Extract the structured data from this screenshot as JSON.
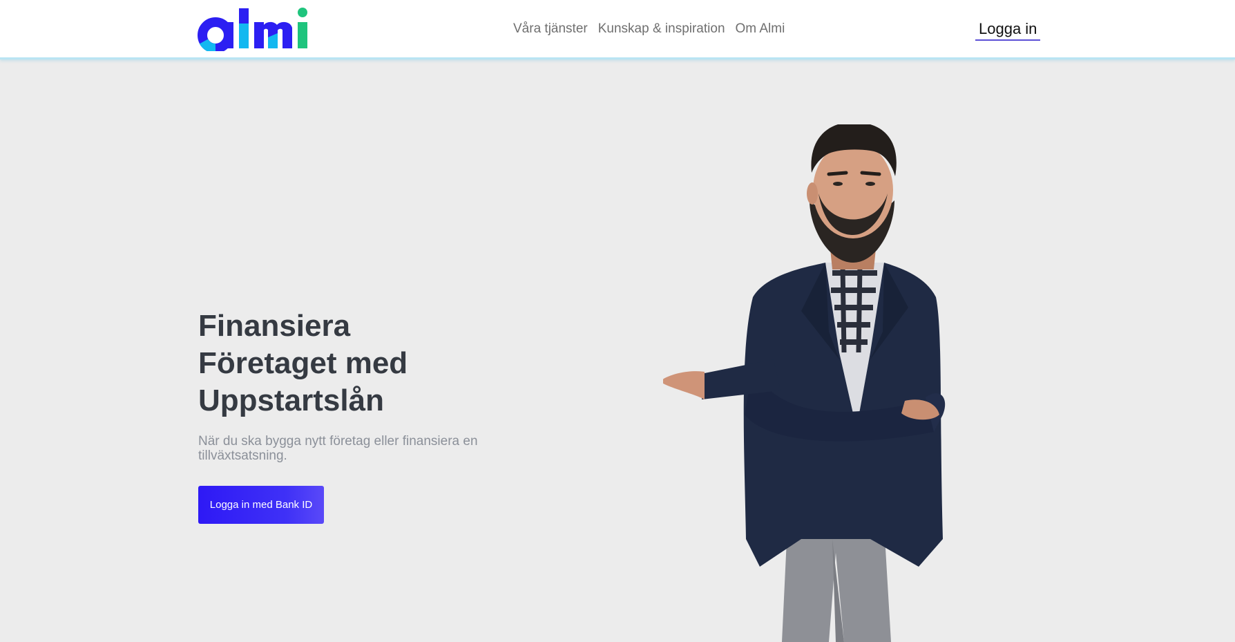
{
  "header": {
    "logo_text": "almi",
    "nav": [
      {
        "label": "Våra tjänster"
      },
      {
        "label": "Kunskap & inspiration"
      },
      {
        "label": "Om Almi"
      }
    ],
    "login_label": "Logga in"
  },
  "hero": {
    "title_lines": [
      "Finansiera",
      "Företaget med",
      "Uppstartslån"
    ],
    "subtitle": "När du ska bygga nytt företag eller finansiera en tillväxtsatsning.",
    "cta_label": "Logga in med Bank ID",
    "image": "smiling-businessman-presenting"
  },
  "colors": {
    "header_bg": "#ffffff",
    "page_bg": "#ececec",
    "cta_bg": "#3a2cf6",
    "title": "#353a42",
    "subtitle": "#8b9099",
    "logo_blue": "#2c1ff2",
    "logo_cyan": "#13b8f0",
    "logo_green": "#1fc47d"
  }
}
